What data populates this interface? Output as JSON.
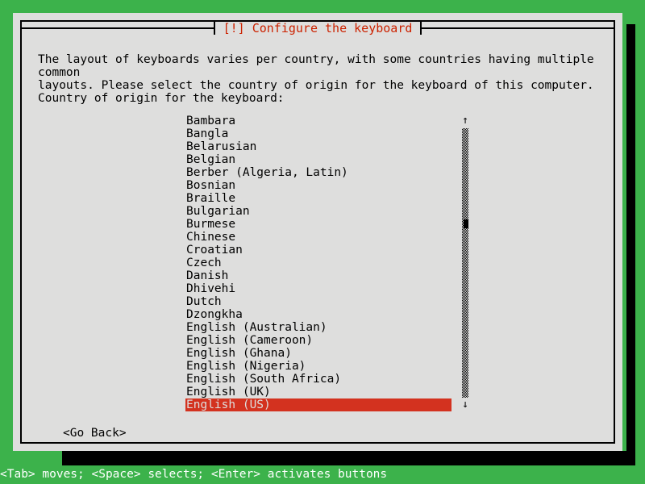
{
  "screen": {
    "background_color": "#3cb24b",
    "dialog_background_color": "#dededd",
    "accent_color": "#cc2200",
    "selection_color": "#d3321f",
    "status_text_color": "#ffffff"
  },
  "dialog": {
    "title": "[!] Configure the keyboard",
    "body_text": "The layout of keyboards varies per country, with some countries having multiple common\nlayouts. Please select the country of origin for the keyboard of this computer.",
    "prompt_label": "Country of origin for the keyboard:",
    "go_back_label": "<Go Back>"
  },
  "list": {
    "selected_index": 22,
    "items": [
      {
        "label": "Bambara"
      },
      {
        "label": "Bangla"
      },
      {
        "label": "Belarusian"
      },
      {
        "label": "Belgian"
      },
      {
        "label": "Berber (Algeria, Latin)"
      },
      {
        "label": "Bosnian"
      },
      {
        "label": "Braille"
      },
      {
        "label": "Bulgarian"
      },
      {
        "label": "Burmese"
      },
      {
        "label": "Chinese"
      },
      {
        "label": "Croatian"
      },
      {
        "label": "Czech"
      },
      {
        "label": "Danish"
      },
      {
        "label": "Dhivehi"
      },
      {
        "label": "Dutch"
      },
      {
        "label": "Dzongkha"
      },
      {
        "label": "English (Australian)"
      },
      {
        "label": "English (Cameroon)"
      },
      {
        "label": "English (Ghana)"
      },
      {
        "label": "English (Nigeria)"
      },
      {
        "label": "English (South Africa)"
      },
      {
        "label": "English (UK)"
      },
      {
        "label": "English (US)"
      }
    ]
  },
  "scrollbar": {
    "up_arrow_glyph": "↑",
    "down_arrow_glyph": "↓",
    "thumb_position_percent": 35
  },
  "status_bar": {
    "text": "<Tab> moves; <Space> selects; <Enter> activates buttons"
  }
}
